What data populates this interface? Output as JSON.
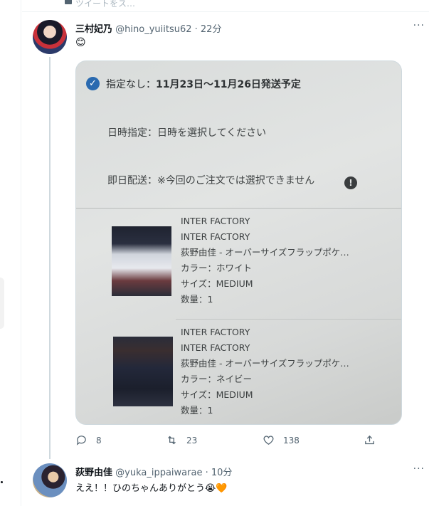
{
  "top_cut": {
    "ghost_text": "ツイートをス…"
  },
  "tweet_main": {
    "name": "三村妃乃",
    "handle": "@hino_yuiitsu62 · 22分",
    "body": "😊",
    "media": {
      "line1_prefix": "指定なし：",
      "line1_bold": "11月23日〜11月26日発送予定",
      "line2": "日時指定：日時を選択してください",
      "line3": "即日配送：※今回のご注文では選択できません",
      "products": [
        {
          "brand": "INTER FACTORY",
          "maker": "INTER FACTORY",
          "item": "荻野由佳 - オーバーサイズフラップポケ…",
          "color": "カラー：ホワイト",
          "size": "サイズ：MEDIUM",
          "qty": "数量：1"
        },
        {
          "brand": "INTER FACTORY",
          "maker": "INTER FACTORY",
          "item": "荻野由佳 - オーバーサイズフラップポケ…",
          "color": "カラー：ネイビー",
          "size": "サイズ：MEDIUM",
          "qty": "数量：1"
        }
      ]
    },
    "actions": {
      "replies": "8",
      "retweets": "23",
      "likes": "138"
    }
  },
  "tweet_reply": {
    "name": "荻野由佳",
    "handle": "@yuka_ippaiwarae · 10分",
    "body": "ええ！！ひのちゃんありがとう😭🧡"
  },
  "colors": {
    "accent": "#1d9bf0",
    "muted": "#536471",
    "text": "#0f1419"
  }
}
